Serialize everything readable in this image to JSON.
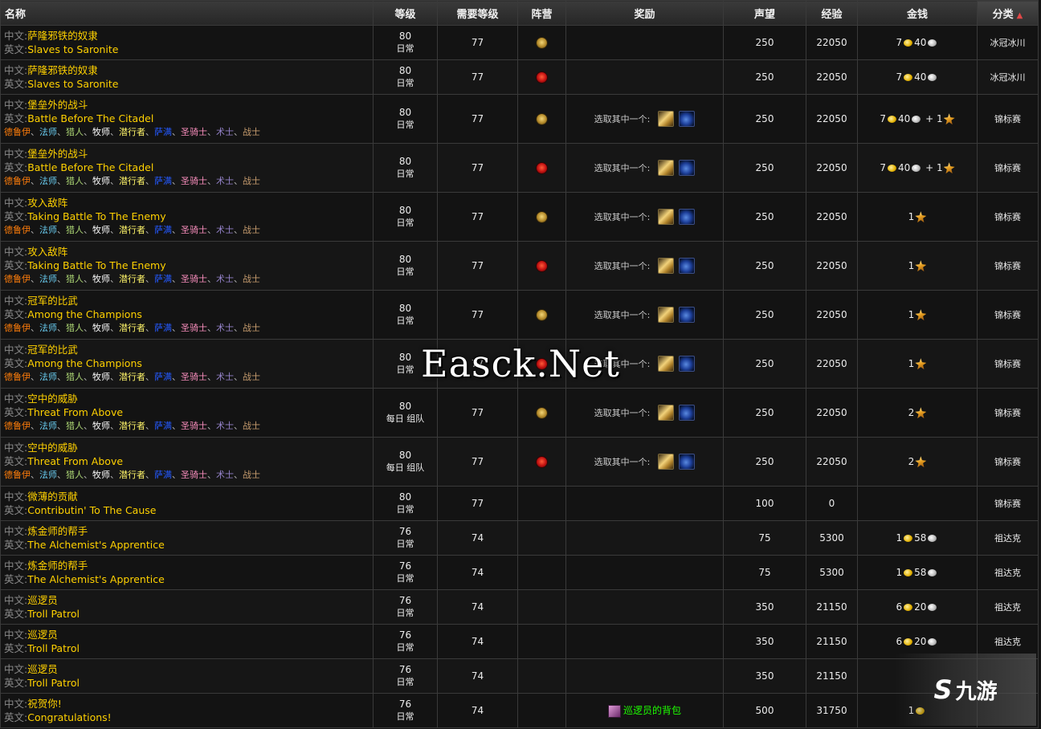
{
  "headers": {
    "name": "名称",
    "level": "等级",
    "req_level": "需要等级",
    "faction": "阵营",
    "reward": "奖励",
    "rep": "声望",
    "xp": "经验",
    "money": "金钱",
    "category": "分类"
  },
  "labels": {
    "zh_prefix": "中文:",
    "en_prefix": "英文:",
    "choose": "选取其中一个:"
  },
  "classes": [
    {
      "name": "德鲁伊",
      "color": "#ff7d0a"
    },
    {
      "name": "法师",
      "color": "#69ccf0"
    },
    {
      "name": "猎人",
      "color": "#abd473"
    },
    {
      "name": "牧师",
      "color": "#ffffff"
    },
    {
      "name": "潜行者",
      "color": "#fff569"
    },
    {
      "name": "萨满",
      "color": "#2459ff"
    },
    {
      "name": "圣骑士",
      "color": "#f58cba"
    },
    {
      "name": "术士",
      "color": "#9482c9"
    },
    {
      "name": "战士",
      "color": "#c79c6e"
    }
  ],
  "rows": [
    {
      "zh": "萨隆邪铁的奴隶",
      "en": "Slaves to Saronite",
      "classes": false,
      "level": "80",
      "type": "日常",
      "req": "77",
      "faction": "alliance",
      "reward": "none",
      "rep": "250",
      "xp": "22050",
      "gold": "7",
      "silver": "40",
      "seals": "",
      "category": "冰冠冰川"
    },
    {
      "zh": "萨隆邪铁的奴隶",
      "en": "Slaves to Saronite",
      "classes": false,
      "level": "80",
      "type": "日常",
      "req": "77",
      "faction": "horde",
      "reward": "none",
      "rep": "250",
      "xp": "22050",
      "gold": "7",
      "silver": "40",
      "seals": "",
      "category": "冰冠冰川"
    },
    {
      "zh": "堡垒外的战斗",
      "en": "Battle Before The Citadel",
      "classes": true,
      "level": "80",
      "type": "日常",
      "req": "77",
      "faction": "alliance",
      "reward": "choose",
      "rep": "250",
      "xp": "22050",
      "gold": "7",
      "silver": "40",
      "seals": "1",
      "category": "锦标赛"
    },
    {
      "zh": "堡垒外的战斗",
      "en": "Battle Before The Citadel",
      "classes": true,
      "level": "80",
      "type": "日常",
      "req": "77",
      "faction": "horde",
      "reward": "choose",
      "rep": "250",
      "xp": "22050",
      "gold": "7",
      "silver": "40",
      "seals": "1",
      "category": "锦标赛"
    },
    {
      "zh": "攻入敌阵",
      "en": "Taking Battle To The Enemy",
      "classes": true,
      "level": "80",
      "type": "日常",
      "req": "77",
      "faction": "alliance",
      "reward": "choose",
      "rep": "250",
      "xp": "22050",
      "gold": "",
      "silver": "",
      "seals": "1",
      "category": "锦标赛"
    },
    {
      "zh": "攻入敌阵",
      "en": "Taking Battle To The Enemy",
      "classes": true,
      "level": "80",
      "type": "日常",
      "req": "77",
      "faction": "horde",
      "reward": "choose",
      "rep": "250",
      "xp": "22050",
      "gold": "",
      "silver": "",
      "seals": "1",
      "category": "锦标赛"
    },
    {
      "zh": "冠军的比武",
      "en": "Among the Champions",
      "classes": true,
      "level": "80",
      "type": "日常",
      "req": "77",
      "faction": "alliance",
      "reward": "choose",
      "rep": "250",
      "xp": "22050",
      "gold": "",
      "silver": "",
      "seals": "1",
      "category": "锦标赛"
    },
    {
      "zh": "冠军的比武",
      "en": "Among the Champions",
      "classes": true,
      "level": "80",
      "type": "日常",
      "req": "77",
      "faction": "horde",
      "reward": "choose",
      "rep": "250",
      "xp": "22050",
      "gold": "",
      "silver": "",
      "seals": "1",
      "category": "锦标赛"
    },
    {
      "zh": "空中的威胁",
      "en": "Threat From Above",
      "classes": true,
      "level": "80",
      "type": "每日 组队",
      "req": "77",
      "faction": "alliance",
      "reward": "choose",
      "rep": "250",
      "xp": "22050",
      "gold": "",
      "silver": "",
      "seals": "2",
      "category": "锦标赛"
    },
    {
      "zh": "空中的威胁",
      "en": "Threat From Above",
      "classes": true,
      "level": "80",
      "type": "每日 组队",
      "req": "77",
      "faction": "horde",
      "reward": "choose",
      "rep": "250",
      "xp": "22050",
      "gold": "",
      "silver": "",
      "seals": "2",
      "category": "锦标赛"
    },
    {
      "zh": "微薄的贡献",
      "en": "Contributin' To The Cause",
      "classes": false,
      "level": "80",
      "type": "日常",
      "req": "77",
      "faction": "",
      "reward": "none",
      "rep": "100",
      "xp": "0",
      "gold": "",
      "silver": "",
      "seals": "",
      "category": "锦标赛"
    },
    {
      "zh": "炼金师的帮手",
      "en": "The Alchemist's Apprentice",
      "classes": false,
      "level": "76",
      "type": "日常",
      "req": "74",
      "faction": "",
      "reward": "none",
      "rep": "75",
      "xp": "5300",
      "gold": "1",
      "silver": "58",
      "seals": "",
      "category": "祖达克"
    },
    {
      "zh": "炼金师的帮手",
      "en": "The Alchemist's Apprentice",
      "classes": false,
      "level": "76",
      "type": "日常",
      "req": "74",
      "faction": "",
      "reward": "none",
      "rep": "75",
      "xp": "5300",
      "gold": "1",
      "silver": "58",
      "seals": "",
      "category": "祖达克"
    },
    {
      "zh": "巡逻员",
      "en": "Troll Patrol",
      "classes": false,
      "level": "76",
      "type": "日常",
      "req": "74",
      "faction": "",
      "reward": "none",
      "rep": "350",
      "xp": "21150",
      "gold": "6",
      "silver": "20",
      "seals": "",
      "category": "祖达克"
    },
    {
      "zh": "巡逻员",
      "en": "Troll Patrol",
      "classes": false,
      "level": "76",
      "type": "日常",
      "req": "74",
      "faction": "",
      "reward": "none",
      "rep": "350",
      "xp": "21150",
      "gold": "6",
      "silver": "20",
      "seals": "",
      "category": "祖达克"
    },
    {
      "zh": "巡逻员",
      "en": "Troll Patrol",
      "classes": false,
      "level": "76",
      "type": "日常",
      "req": "74",
      "faction": "",
      "reward": "none",
      "rep": "350",
      "xp": "21150",
      "gold": "",
      "silver": "",
      "seals": "",
      "category": ""
    },
    {
      "zh": "祝贺你!",
      "en": "Congratulations!",
      "classes": false,
      "level": "76",
      "type": "日常",
      "req": "74",
      "faction": "",
      "reward": "item",
      "item": "巡逻员的背包",
      "rep": "500",
      "xp": "31750",
      "gold": "1",
      "silver": "",
      "seals": "",
      "category": ""
    }
  ],
  "watermark": "Easck.Net",
  "logo": {
    "mark": "S",
    "text": "九游"
  },
  "icons": {
    "sort": "sort-up-icon",
    "alliance": "alliance-icon",
    "horde": "horde-icon",
    "scroll": "scroll-icon",
    "bomb": "bomb-icon",
    "gold": "gold-coin-icon",
    "silver": "silver-coin-icon",
    "seal": "champion-seal-icon",
    "bag": "bag-icon"
  }
}
